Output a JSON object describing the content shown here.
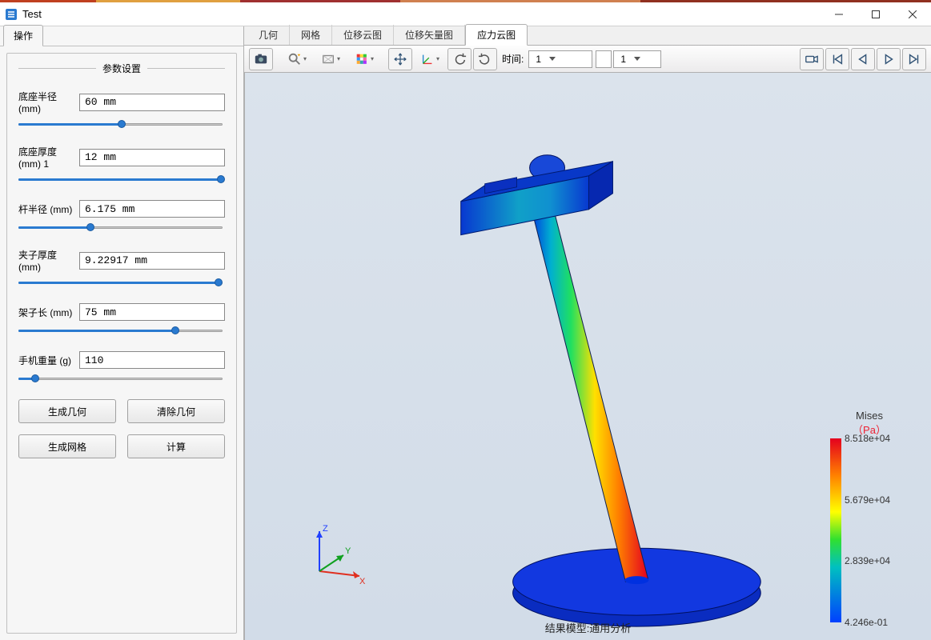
{
  "window": {
    "title": "Test"
  },
  "left_panel": {
    "tab": "操作",
    "section_title": "参数设置",
    "params": [
      {
        "label": "底座半径 (mm)",
        "value": "60 mm",
        "slider_pct": 50
      },
      {
        "label": "底座厚度 (mm) 1",
        "value": "12 mm",
        "slider_pct": 98
      },
      {
        "label": "杆半径 (mm)",
        "value": "6.175 mm",
        "slider_pct": 35
      },
      {
        "label": "夹子厚度 (mm)",
        "value": "9.22917 mm",
        "slider_pct": 97
      },
      {
        "label": "架子长 (mm)",
        "value": "75 mm",
        "slider_pct": 76
      },
      {
        "label": "手机重量 (g)",
        "value": "110",
        "slider_pct": 8
      }
    ],
    "buttons": {
      "gen_geo": "生成几何",
      "clear_geo": "清除几何",
      "gen_mesh": "生成网格",
      "compute": "计算"
    }
  },
  "right_tabs": {
    "items": [
      "几何",
      "网格",
      "位移云图",
      "位移矢量图",
      "应力云图"
    ],
    "active_index": 4
  },
  "toolbar": {
    "time_label": "时间:",
    "time_select": "1",
    "time_input": "1"
  },
  "viewport": {
    "result_label": "结果模型:通用分析",
    "triad_axes": {
      "x": "X",
      "y": "Y",
      "z": "Z"
    }
  },
  "legend": {
    "title": "Mises",
    "unit": "（Pa）",
    "ticks": [
      {
        "label": "8.518e+04",
        "pos_pct": 0
      },
      {
        "label": "5.679e+04",
        "pos_pct": 33.3
      },
      {
        "label": "2.839e+04",
        "pos_pct": 66.6
      },
      {
        "label": "4.246e-01",
        "pos_pct": 100
      }
    ]
  },
  "chart_data": {
    "type": "heatmap",
    "quantity": "von Mises stress",
    "unit": "Pa",
    "range": [
      0.4246,
      85180
    ],
    "ticks": [
      0.4246,
      28390,
      56790,
      85180
    ],
    "colormap": "rainbow (blue→green→yellow→red)",
    "note": "3D FEA result on phone-stand model (circular base, tilted rod, top clamp). Base & clamp ≈ low stress (blue). Rod shows high gradient bending stress, red side ≈ 8.5e4 Pa, blue side ≈ 0."
  }
}
